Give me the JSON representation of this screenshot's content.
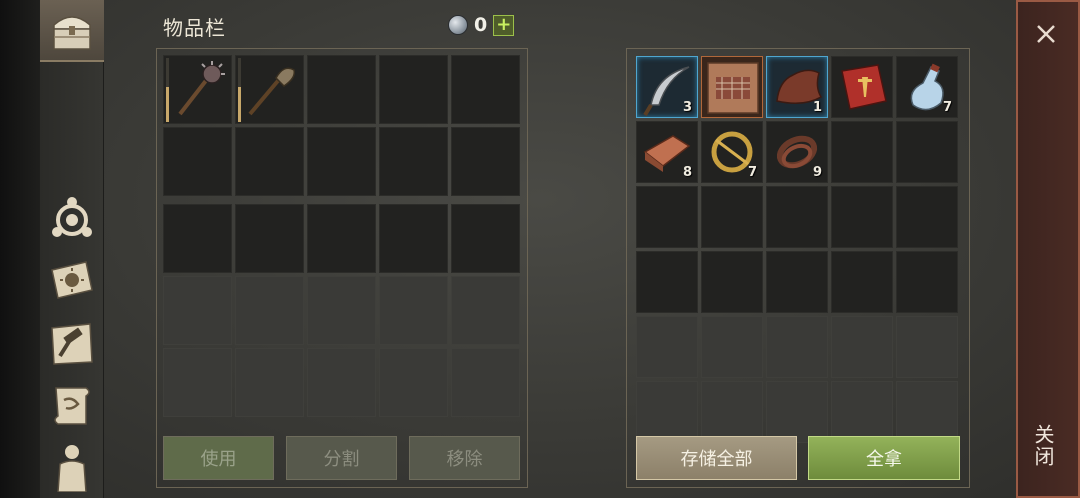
{
  "inventory": {
    "title": "物品栏",
    "currency_value": "0",
    "currency_plus": "+",
    "slots": [
      {
        "item": "mace-icon",
        "durability": 0.55
      },
      {
        "item": "club-icon",
        "durability": 0.55
      }
    ],
    "buttons": {
      "use": "使用",
      "split": "分割",
      "remove": "移除"
    }
  },
  "container": {
    "items": [
      {
        "item": "sickle-icon",
        "qty": "3",
        "highlight": "blue"
      },
      {
        "item": "blueprint-icon",
        "qty": "",
        "highlight": "orange"
      },
      {
        "item": "hide-icon",
        "qty": "1",
        "highlight": "blue"
      },
      {
        "item": "book-icon",
        "qty": ""
      },
      {
        "item": "bottle-icon",
        "qty": "7"
      },
      {
        "item": "copper-ingot-icon",
        "qty": "8"
      },
      {
        "item": "brooch-icon",
        "qty": "7"
      },
      {
        "item": "leather-strap-icon",
        "qty": "9"
      }
    ],
    "buttons": {
      "store_all": "存储全部",
      "take_all": "全拿"
    }
  },
  "close": {
    "label": "关闭"
  },
  "colors": {
    "accent_green": "#8fb056",
    "blue_highlight": "#4fa6cf",
    "close_border": "#9a5a44"
  }
}
